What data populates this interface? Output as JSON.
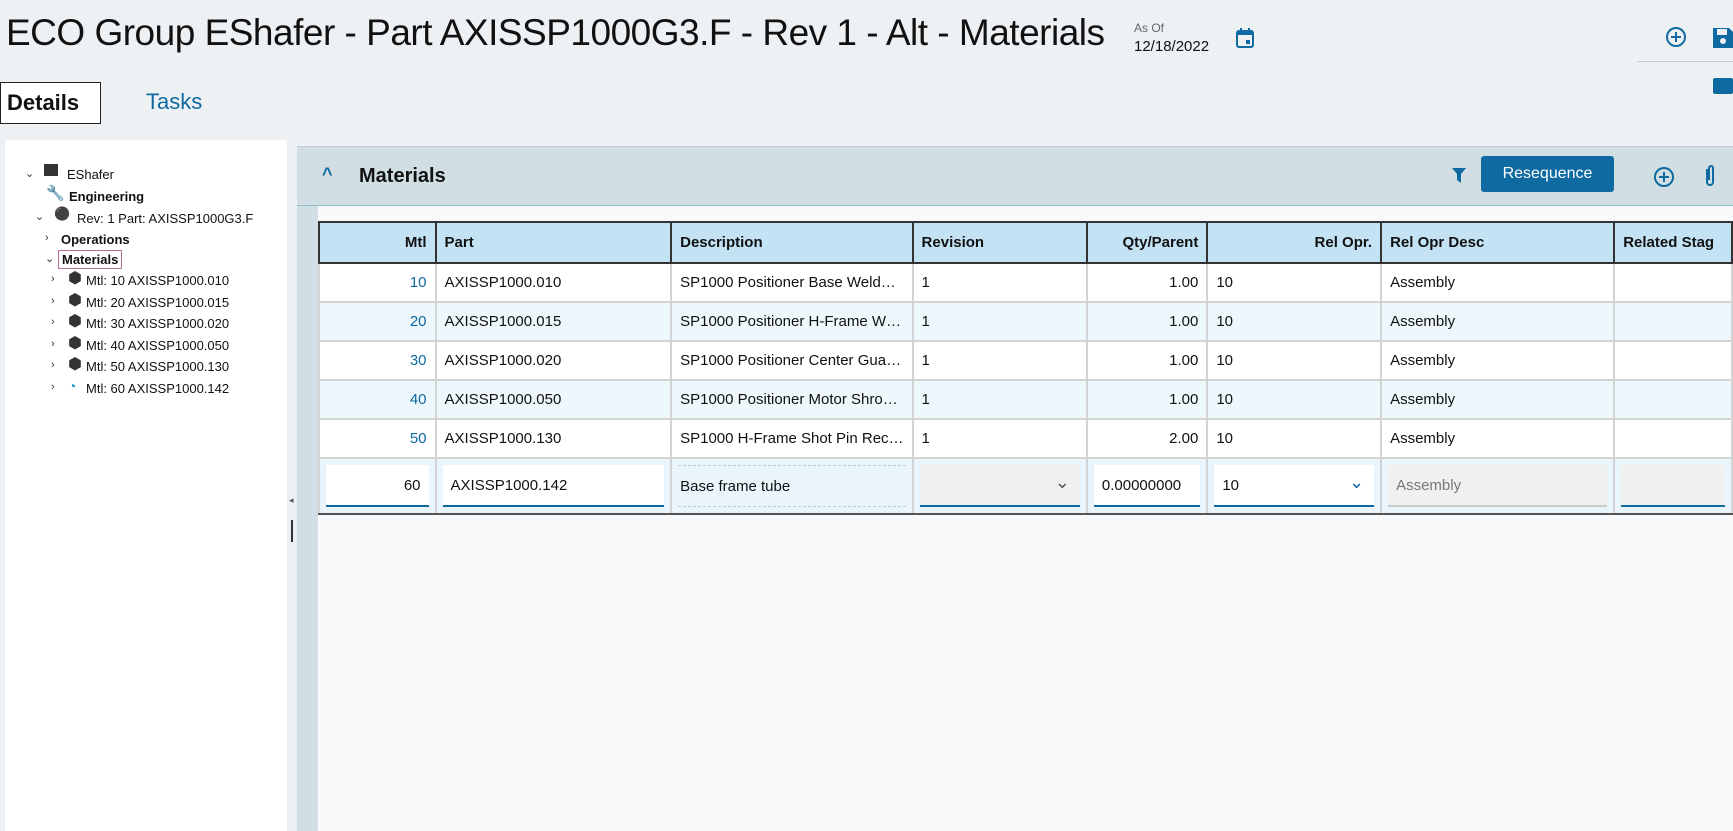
{
  "header": {
    "title": "ECO Group EShafer - Part AXISSP1000G3.F - Rev 1 - Alt - Materials",
    "as_of_label": "As Of",
    "as_of_date": "12/18/2022"
  },
  "tabs": [
    {
      "label": "Details"
    },
    {
      "label": "Tasks"
    }
  ],
  "tree": {
    "root": "EShafer",
    "engineering": "Engineering",
    "revision": "Rev: 1 Part: AXISSP1000G3.F",
    "operations": "Operations",
    "materials": "Materials",
    "items": [
      "Mtl: 10 AXISSP1000.010",
      "Mtl: 20 AXISSP1000.015",
      "Mtl: 30 AXISSP1000.020",
      "Mtl: 40 AXISSP1000.050",
      "Mtl: 50 AXISSP1000.130",
      "Mtl: 60 AXISSP1000.142"
    ]
  },
  "panel": {
    "title": "Materials",
    "resequence": "Resequence"
  },
  "table": {
    "columns": [
      "Mtl",
      "Part",
      "Description",
      "Revision",
      "Qty/Parent",
      "Rel Opr.",
      "Rel Opr Desc",
      "Related Stag"
    ],
    "rows": [
      [
        "10",
        "AXISSP1000.010",
        "SP1000 Positioner Base Weld…",
        "1",
        "1.00",
        "10",
        "Assembly"
      ],
      [
        "20",
        "AXISSP1000.015",
        "SP1000 Positioner H-Frame W…",
        "1",
        "1.00",
        "10",
        "Assembly"
      ],
      [
        "30",
        "AXISSP1000.020",
        "SP1000 Positioner Center Gua…",
        "1",
        "1.00",
        "10",
        "Assembly"
      ],
      [
        "40",
        "AXISSP1000.050",
        "SP1000 Positioner Motor Shro…",
        "1",
        "1.00",
        "10",
        "Assembly"
      ],
      [
        "50",
        "AXISSP1000.130",
        "SP1000 H-Frame Shot Pin Rec…",
        "1",
        "2.00",
        "10",
        "Assembly"
      ]
    ],
    "edit_row": {
      "mtl": "60",
      "part": "AXISSP1000.142",
      "description": "Base frame tube",
      "revision": "",
      "qty": "0.00000000",
      "rel_opr": "10",
      "rel_opr_desc": "Assembly"
    }
  }
}
